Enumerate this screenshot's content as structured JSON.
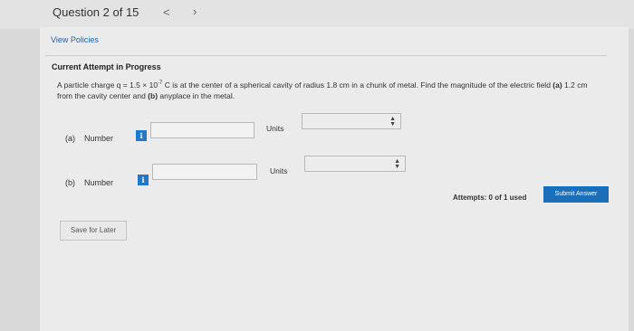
{
  "header": {
    "question_label": "Question 2 of 15",
    "prev_icon": "chevron-left-icon",
    "next_icon": "chevron-right-icon"
  },
  "links": {
    "view_policies": "View Policies"
  },
  "attempt": {
    "title": "Current Attempt in Progress"
  },
  "problem": {
    "part1": "A particle charge q = 1.5 × 10",
    "exp": "-7",
    "part2": " C is at the center of a spherical cavity of radius 1.8 cm in a chunk of metal. Find the magnitude of the electric field ",
    "a_bold": "(a)",
    "part3": " 1.2 cm from the cavity center and ",
    "b_bold": "(b)",
    "part4": " anyplace in the metal."
  },
  "parts": [
    {
      "label": "(a)",
      "number_label": "Number",
      "info": "i",
      "value": "",
      "units_label": "Units",
      "units_value": ""
    },
    {
      "label": "(b)",
      "number_label": "Number",
      "info": "i",
      "value": "",
      "units_label": "Units",
      "units_value": ""
    }
  ],
  "footer": {
    "attempts_text": "Attempts: 0 of 1 used",
    "submit_label": "Submit Answer",
    "save_label": "Save for Later"
  },
  "colors": {
    "accent": "#1b6fb8",
    "info_button": "#1f78c8",
    "link": "#2a5e96"
  }
}
